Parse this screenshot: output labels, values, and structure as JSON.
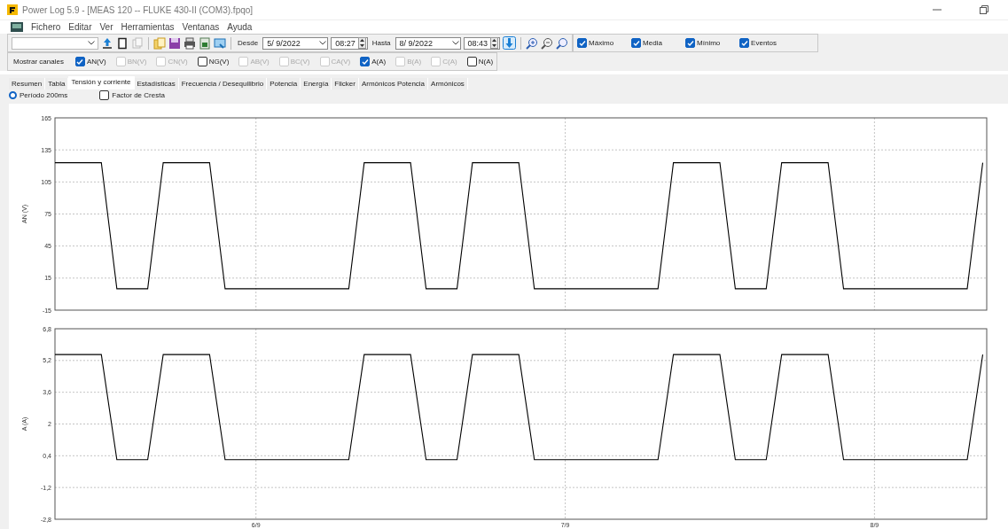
{
  "window": {
    "title": "Power Log 5.9 - [MEAS 120 -- FLUKE 430-II (COM3).fpqo]"
  },
  "menu": [
    "Fichero",
    "Editar",
    "Ver",
    "Herramientas",
    "Ventanas",
    "Ayuda"
  ],
  "toolbar": {
    "from_label": "Desde",
    "from_date": "5/ 9/2022",
    "from_time": "08:27",
    "to_label": "Hasta",
    "to_date": "8/ 9/2022",
    "to_time": "08:43",
    "options": [
      {
        "label": "Máximo",
        "checked": true
      },
      {
        "label": "Media",
        "checked": true
      },
      {
        "label": "Mínimo",
        "checked": true
      },
      {
        "label": "Eventos",
        "checked": true
      }
    ]
  },
  "channels": {
    "label": "Mostrar canales",
    "items": [
      {
        "label": "AN(V)",
        "checked": true,
        "disabled": false
      },
      {
        "label": "BN(V)",
        "checked": false,
        "disabled": true
      },
      {
        "label": "CN(V)",
        "checked": false,
        "disabled": true
      },
      {
        "label": "NG(V)",
        "checked": false,
        "disabled": false
      },
      {
        "label": "AB(V)",
        "checked": false,
        "disabled": true
      },
      {
        "label": "BC(V)",
        "checked": false,
        "disabled": true
      },
      {
        "label": "CA(V)",
        "checked": false,
        "disabled": true
      },
      {
        "label": "A(A)",
        "checked": true,
        "disabled": false
      },
      {
        "label": "B(A)",
        "checked": false,
        "disabled": true
      },
      {
        "label": "C(A)",
        "checked": false,
        "disabled": true
      },
      {
        "label": "N(A)",
        "checked": false,
        "disabled": false
      }
    ]
  },
  "tabs": [
    {
      "label": "Resumen",
      "selected": false
    },
    {
      "label": "Tabla",
      "selected": false
    },
    {
      "label": "Tensión y corriente",
      "selected": true
    },
    {
      "label": "Estadísticas",
      "selected": false
    },
    {
      "label": "Frecuencia / Desequilibrio",
      "selected": false
    },
    {
      "label": "Potencia",
      "selected": false
    },
    {
      "label": "Energía",
      "selected": false
    },
    {
      "label": "Flicker",
      "selected": false
    },
    {
      "label": "Armónicos Potencia",
      "selected": false
    },
    {
      "label": "Armónicos",
      "selected": false
    }
  ],
  "view_options": [
    {
      "kind": "radio",
      "label": "Período 200ms",
      "checked": true
    },
    {
      "kind": "checkbox",
      "label": "Factor de Cresta",
      "checked": false
    }
  ],
  "charts": [
    {
      "chart_data": {
        "type": "line",
        "grid": true,
        "ylabel": "AN (V)",
        "ylim": [
          -15,
          165
        ],
        "yticks": [
          -15,
          15,
          45,
          75,
          105,
          135,
          165
        ],
        "categories": [
          null,
          null,
          null,
          null,
          null,
          null,
          null,
          null,
          null,
          null,
          null,
          null,
          null,
          null,
          null,
          null,
          null,
          null,
          null,
          null,
          null,
          null,
          null,
          null,
          null,
          null,
          null,
          null,
          null,
          null,
          null,
          null,
          null,
          null,
          null,
          null,
          null,
          null,
          null,
          null,
          null,
          null,
          null,
          null,
          null,
          null,
          null,
          null,
          null,
          null,
          null,
          null,
          null,
          null,
          null,
          null,
          null,
          null,
          null,
          null,
          null
        ],
        "series": [
          {
            "color": "#000000",
            "values": [
              123,
              123,
              123,
              123,
              5,
              5,
              5,
              123,
              123,
              123,
              123,
              5,
              5,
              5,
              5,
              5,
              5,
              5,
              5,
              5,
              123,
              123,
              123,
              123,
              5,
              5,
              5,
              123,
              123,
              123,
              123,
              5,
              5,
              5,
              5,
              5,
              5,
              5,
              5,
              5,
              123,
              123,
              123,
              123,
              5,
              5,
              5,
              123,
              123,
              123,
              123,
              5,
              5,
              5,
              5,
              5,
              5,
              5,
              5,
              5,
              123
            ]
          }
        ]
      }
    },
    {
      "chart_data": {
        "type": "line",
        "grid": true,
        "ylabel": "A (A)",
        "ylim": [
          -2.8,
          6.8
        ],
        "yticks": [
          {
            "value": -2.8,
            "label": "-2,8"
          },
          {
            "value": -1.2,
            "label": "-1,2"
          },
          {
            "value": 0.4,
            "label": "0,4"
          },
          2,
          {
            "value": 3.6,
            "label": "3,6"
          },
          {
            "value": 5.2,
            "label": "5,2"
          },
          {
            "value": 6.8,
            "label": "6,8"
          }
        ],
        "categories": [
          null,
          null,
          null,
          null,
          null,
          null,
          null,
          null,
          null,
          null,
          null,
          null,
          null,
          "6/9",
          null,
          null,
          null,
          null,
          null,
          null,
          null,
          null,
          null,
          null,
          null,
          null,
          null,
          null,
          null,
          null,
          null,
          null,
          null,
          "7/9",
          null,
          null,
          null,
          null,
          null,
          null,
          null,
          null,
          null,
          null,
          null,
          null,
          null,
          null,
          null,
          null,
          null,
          null,
          null,
          "8/9",
          null,
          null,
          null,
          null,
          null,
          null,
          null
        ],
        "series": [
          {
            "color": "#000000",
            "values": [
              5.5,
              5.5,
              5.5,
              5.5,
              0.2,
              0.2,
              0.2,
              5.5,
              5.5,
              5.5,
              5.5,
              0.2,
              0.2,
              0.2,
              0.2,
              0.2,
              0.2,
              0.2,
              0.2,
              0.2,
              5.5,
              5.5,
              5.5,
              5.5,
              0.2,
              0.2,
              0.2,
              5.5,
              5.5,
              5.5,
              5.5,
              0.2,
              0.2,
              0.2,
              0.2,
              0.2,
              0.2,
              0.2,
              0.2,
              0.2,
              5.5,
              5.5,
              5.5,
              5.5,
              0.2,
              0.2,
              0.2,
              5.5,
              5.5,
              5.5,
              5.5,
              0.2,
              0.2,
              0.2,
              0.2,
              0.2,
              0.2,
              0.2,
              0.2,
              0.2,
              5.5
            ]
          }
        ]
      }
    }
  ]
}
